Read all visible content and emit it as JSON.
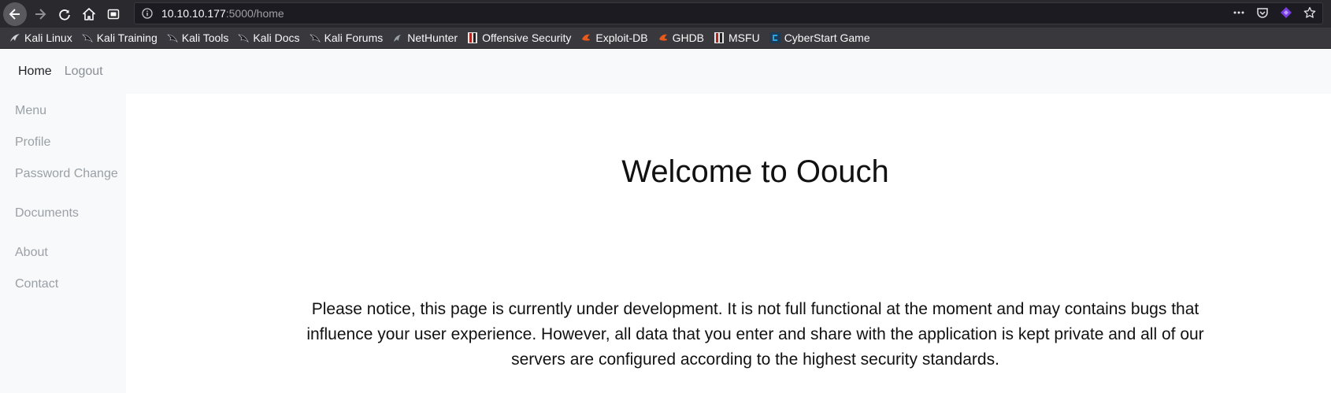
{
  "browser": {
    "url_host": "10.10.10.177",
    "url_path": ":5000/home",
    "bookmarks": [
      {
        "label": "Kali Linux",
        "icon": "kali-dragon-icon"
      },
      {
        "label": "Kali Training",
        "icon": "kali-dragon-icon"
      },
      {
        "label": "Kali Tools",
        "icon": "kali-dragon-icon"
      },
      {
        "label": "Kali Docs",
        "icon": "kali-dragon-icon"
      },
      {
        "label": "Kali Forums",
        "icon": "kali-dragon-icon"
      },
      {
        "label": "NetHunter",
        "icon": "kali-dragon-icon"
      },
      {
        "label": "Offensive Security",
        "icon": "offsec-icon"
      },
      {
        "label": "Exploit-DB",
        "icon": "exploit-db-icon"
      },
      {
        "label": "GHDB",
        "icon": "exploit-db-icon"
      },
      {
        "label": "MSFU",
        "icon": "offsec-icon"
      },
      {
        "label": "CyberStart Game",
        "icon": "cyberstart-icon"
      }
    ],
    "colors": {
      "chrome": "#2a2a2e",
      "bookmarks_bar": "#38383d",
      "exploit_db": "#e8591a",
      "cyberstart": "#2aa3d8"
    }
  },
  "topnav": {
    "home": "Home",
    "logout": "Logout"
  },
  "sidebar": {
    "items": [
      "Menu",
      "Profile",
      "Password Change",
      "Documents",
      "About",
      "Contact"
    ]
  },
  "main": {
    "title": "Welcome to Oouch",
    "intro": "Please notice, this page is currently under development. It is not full functional at the moment and may contains bugs that influence your user experience. However, all data that you enter and share with the application is kept private and all of our servers are configured according to the highest security standards."
  }
}
